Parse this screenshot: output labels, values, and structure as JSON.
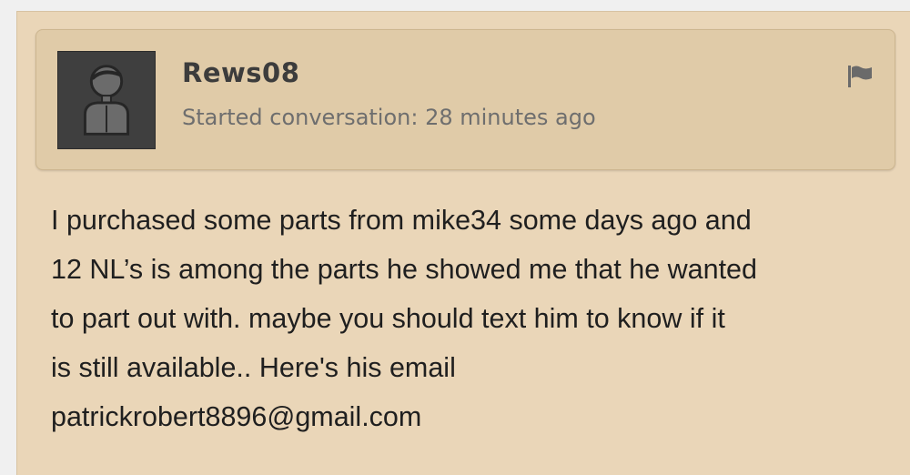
{
  "post": {
    "author": "Rews08",
    "meta_text": "Started conversation: 28 minutes ago",
    "icons": {
      "avatar": "default-user-avatar-icon",
      "report": "flag-icon"
    },
    "message": "I purchased some parts from mike34 some days ago and\n12 NL’s is among the parts he showed me that he wanted\nto part out with. maybe you should text him to know if it\nis still available.. Here's his email\npatrickrobert8896@gmail.com"
  },
  "colors": {
    "panel_bg": "#ead6b8",
    "header_bg": "#e0cba8",
    "avatar_bg": "#3f3f3f",
    "text": "#1f1f1f",
    "muted": "#6e6e6e"
  }
}
